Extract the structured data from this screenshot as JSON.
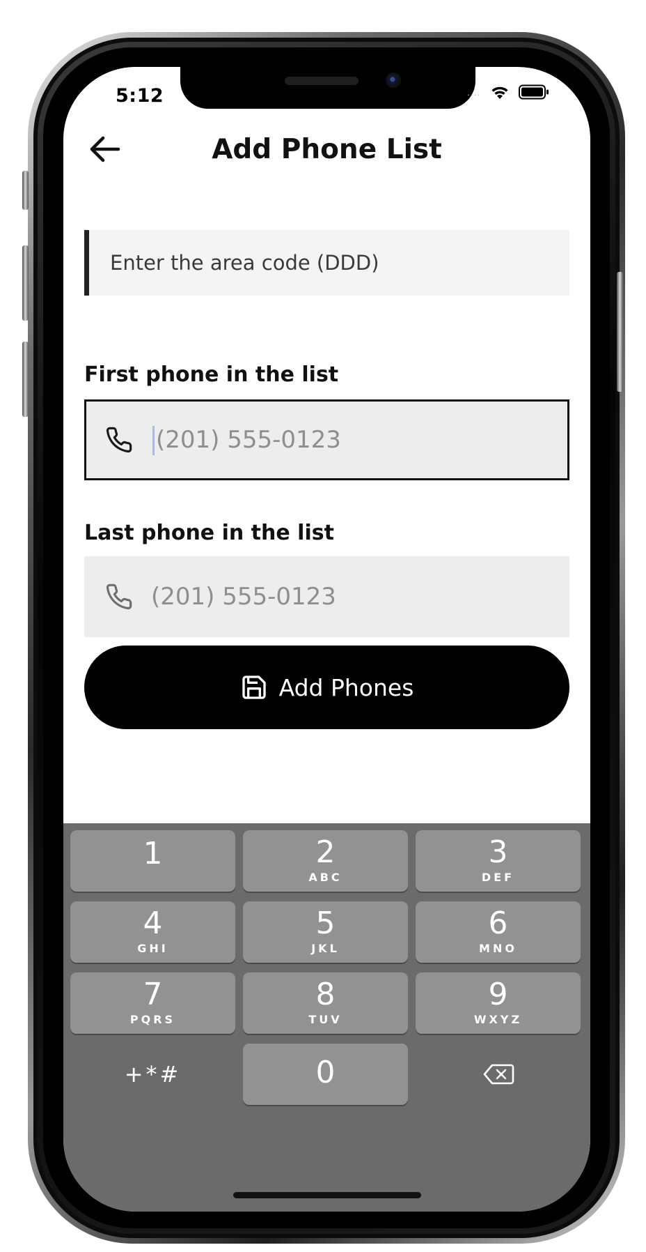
{
  "status_bar": {
    "time": "5:12",
    "signal_dots": "....",
    "wifi_icon": "wifi-icon",
    "battery_icon": "battery-icon"
  },
  "header": {
    "back_icon": "arrow-left-icon",
    "title": "Add Phone List"
  },
  "form": {
    "area_code": {
      "placeholder": "Enter the area code (DDD)",
      "value": ""
    },
    "first_phone": {
      "label": "First phone in the list",
      "placeholder": "(201) 555-0123",
      "value": "",
      "icon": "phone-icon"
    },
    "last_phone": {
      "label": "Last phone in the list",
      "placeholder": "(201) 555-0123",
      "value": "",
      "icon": "phone-icon"
    },
    "submit": {
      "label": "Add Phones",
      "icon": "save-icon"
    }
  },
  "keyboard": {
    "keys": [
      {
        "digit": "1",
        "letters": ""
      },
      {
        "digit": "2",
        "letters": "ABC"
      },
      {
        "digit": "3",
        "letters": "DEF"
      },
      {
        "digit": "4",
        "letters": "GHI"
      },
      {
        "digit": "5",
        "letters": "JKL"
      },
      {
        "digit": "6",
        "letters": "MNO"
      },
      {
        "digit": "7",
        "letters": "PQRS"
      },
      {
        "digit": "8",
        "letters": "TUV"
      },
      {
        "digit": "9",
        "letters": "WXYZ"
      },
      {
        "digit": "0",
        "letters": ""
      }
    ],
    "symbols_label": "+*#",
    "delete_icon": "backspace-icon"
  },
  "colors": {
    "button_bg": "#000000",
    "keyboard_bg": "#6b6b6b",
    "key_bg": "#929292",
    "field_bg": "#ededed",
    "caret": "#a9b3ff"
  }
}
